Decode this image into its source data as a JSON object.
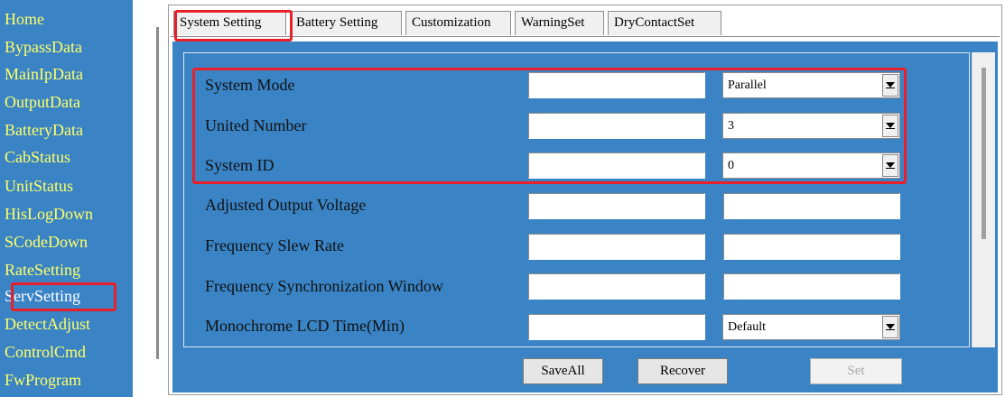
{
  "sidebar": {
    "items": [
      {
        "label": "Home"
      },
      {
        "label": "BypassData"
      },
      {
        "label": "MainIpData"
      },
      {
        "label": "OutputData"
      },
      {
        "label": "BatteryData"
      },
      {
        "label": "CabStatus"
      },
      {
        "label": "UnitStatus"
      },
      {
        "label": "HisLogDown"
      },
      {
        "label": "SCodeDown"
      },
      {
        "label": "RateSetting"
      },
      {
        "label": "ServSetting"
      },
      {
        "label": "DetectAdjust"
      },
      {
        "label": "ControlCmd"
      },
      {
        "label": "FwProgram"
      }
    ],
    "active": "ServSetting"
  },
  "tabs": [
    {
      "label": "System Setting"
    },
    {
      "label": "Battery Setting"
    },
    {
      "label": "Customization"
    },
    {
      "label": "WarningSet"
    },
    {
      "label": "DryContactSet"
    }
  ],
  "settings": {
    "rows": [
      {
        "label": "System Mode",
        "current_value": "",
        "select_value": "Parallel"
      },
      {
        "label": "United Number",
        "current_value": "",
        "select_value": "3"
      },
      {
        "label": "System ID",
        "current_value": "",
        "select_value": "0"
      },
      {
        "label": "Adjusted Output Voltage",
        "current_value": "",
        "set_value": ""
      },
      {
        "label": "Frequency Slew Rate",
        "current_value": "",
        "set_value": ""
      },
      {
        "label": "Frequency Synchronization Window",
        "current_value": "",
        "set_value": ""
      },
      {
        "label": "Monochrome LCD Time(Min)",
        "current_value": "",
        "select_value": "Default"
      }
    ]
  },
  "buttons": {
    "save_all": "SaveAll",
    "recover": "Recover",
    "set": "Set"
  },
  "colors": {
    "background_blue": "#3a84c6",
    "nav_text": "#ffff66",
    "nav_active_text": "#ffffff",
    "highlight_red": "#e8202a"
  }
}
